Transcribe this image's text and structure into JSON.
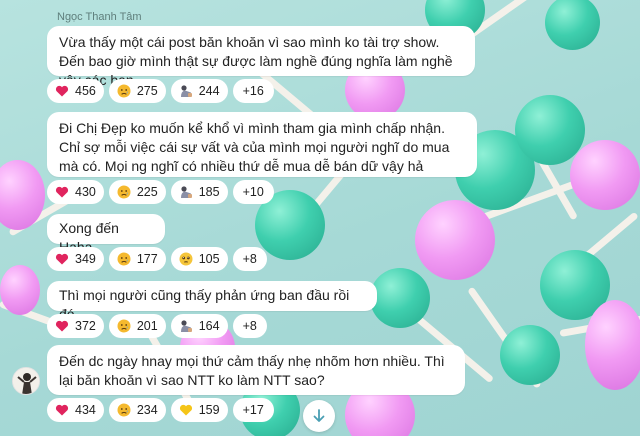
{
  "chat": {
    "sender_name": "Ngọc Thanh Tâm",
    "messages": [
      {
        "text": "Vừa thấy một cái post băn khoăn vì sao mình ko tài trợ show. Đến bao giờ mình thật sự được làm nghề đúng nghĩa làm nghề vậy các bạn",
        "reactions": [
          {
            "icon": "heart-icon",
            "count": "456"
          },
          {
            "icon": "sad-face-icon",
            "count": "275"
          },
          {
            "icon": "bowing-person-icon",
            "count": "244"
          },
          {
            "more": "+16"
          }
        ]
      },
      {
        "text": "Đi Chị Đẹp ko muốn kể khổ vì mình tham gia mình chấp nhận. Chỉ sợ mỗi việc cái sự vất và của mình mọi người nghĩ do mua mà có. Mọi ng nghĩ có nhiều thứ dễ mua dễ bán dữ vậy hả",
        "reactions": [
          {
            "icon": "heart-icon",
            "count": "430"
          },
          {
            "icon": "sad-face-icon",
            "count": "225"
          },
          {
            "icon": "bowing-person-icon",
            "count": "185"
          },
          {
            "more": "+10"
          }
        ]
      },
      {
        "text": "Xong đến Haha",
        "reactions": [
          {
            "icon": "heart-icon",
            "count": "349"
          },
          {
            "icon": "sad-face-icon",
            "count": "177"
          },
          {
            "icon": "teary-face-icon",
            "count": "105"
          },
          {
            "more": "+8"
          }
        ]
      },
      {
        "text": "Thì mọi người cũng thấy phản ứng ban đầu rồi đó.",
        "reactions": [
          {
            "icon": "heart-icon",
            "count": "372"
          },
          {
            "icon": "sad-face-icon",
            "count": "201"
          },
          {
            "icon": "bowing-person-icon",
            "count": "164"
          },
          {
            "more": "+8"
          }
        ]
      },
      {
        "text": "Đến dc ngày hnay mọi thứ cảm thấy nhẹ nhõm hơn nhiều. Thì lại băn khoăn vì sao NTT ko làm NTT sao?",
        "reactions": [
          {
            "icon": "heart-icon",
            "count": "434"
          },
          {
            "icon": "sad-face-icon",
            "count": "234"
          },
          {
            "icon": "yellow-heart-icon",
            "count": "159"
          },
          {
            "more": "+17"
          }
        ]
      }
    ],
    "scroll_button_icon": "arrow-down-icon",
    "colors": {
      "background": "#a9dcd9",
      "bubble": "#ffffff",
      "heart": "#e0245e",
      "yellow_heart": "#f5c518",
      "sad_face": "#f5b92e"
    }
  }
}
